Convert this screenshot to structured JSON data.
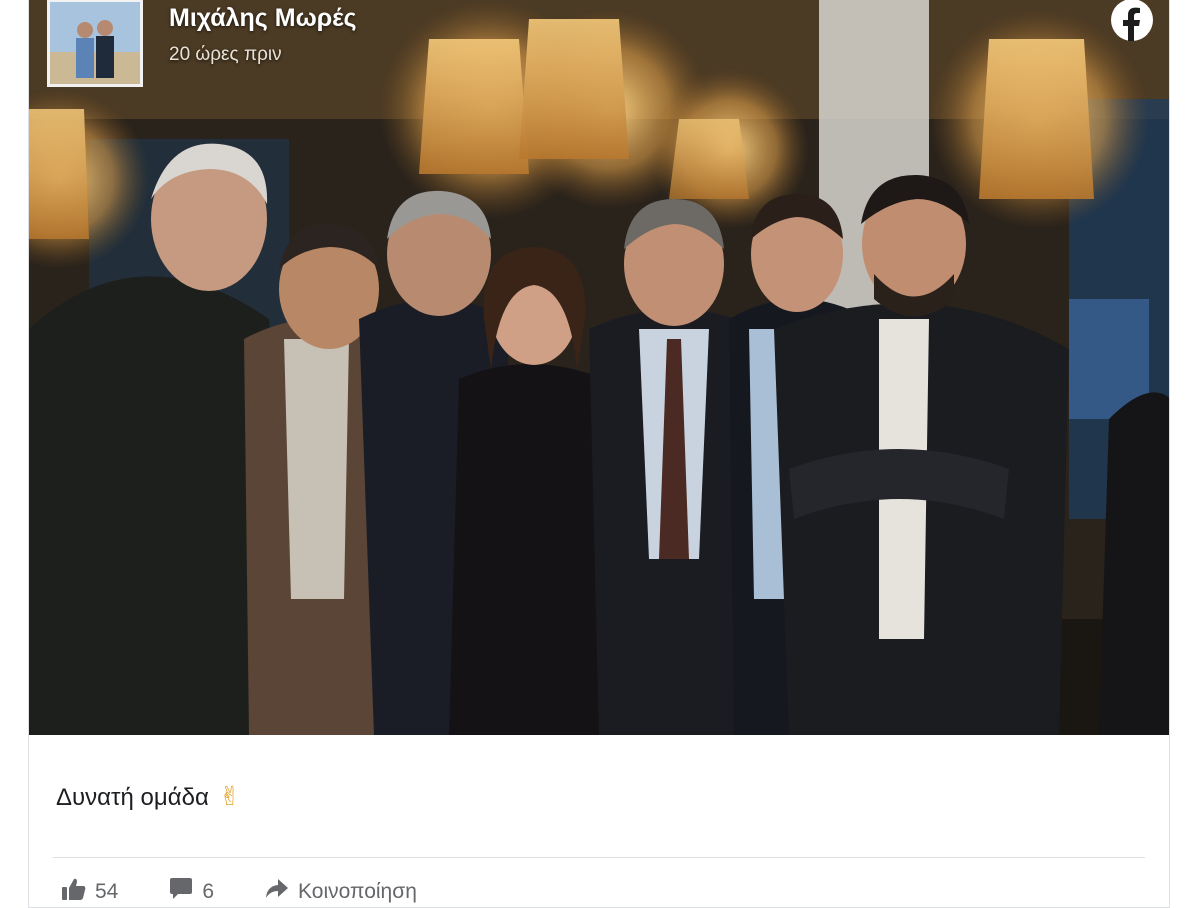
{
  "post": {
    "author": "Μιχάλης Μωρές",
    "time": "20 ώρες πριν",
    "caption": "Δυνατή ομάδα",
    "caption_emoji": "✌"
  },
  "footer": {
    "likes": "54",
    "comments": "6",
    "share_label": "Κοινοποίηση"
  },
  "colors": {
    "text": "#1c1e21",
    "muted": "#65676b",
    "border": "#dddfe2"
  },
  "icons": [
    "facebook-logo-icon",
    "like-icon",
    "comment-icon",
    "share-icon"
  ]
}
